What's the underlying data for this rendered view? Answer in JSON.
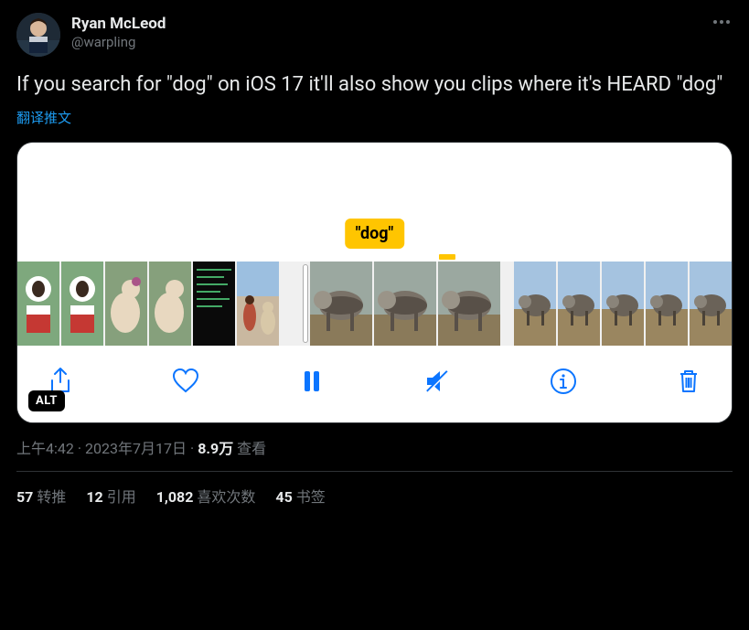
{
  "user": {
    "display_name": "Ryan McLeod",
    "handle": "@warpling"
  },
  "tweet": {
    "text": "If you search for \"dog\" on iOS 17 it'll also show you clips where it's HEARD \"dog\"",
    "translate_label": "翻译推文"
  },
  "media": {
    "tag_label": "\"dog\"",
    "alt_badge": "ALT"
  },
  "meta": {
    "time": "上午4:42",
    "date": "2023年7月17日",
    "views_count": "8.9万",
    "views_label": "查看"
  },
  "stats": {
    "retweets_count": "57",
    "retweets_label": "转推",
    "quotes_count": "12",
    "quotes_label": "引用",
    "likes_count": "1,082",
    "likes_label": "喜欢次数",
    "bookmarks_count": "45",
    "bookmarks_label": "书签"
  }
}
